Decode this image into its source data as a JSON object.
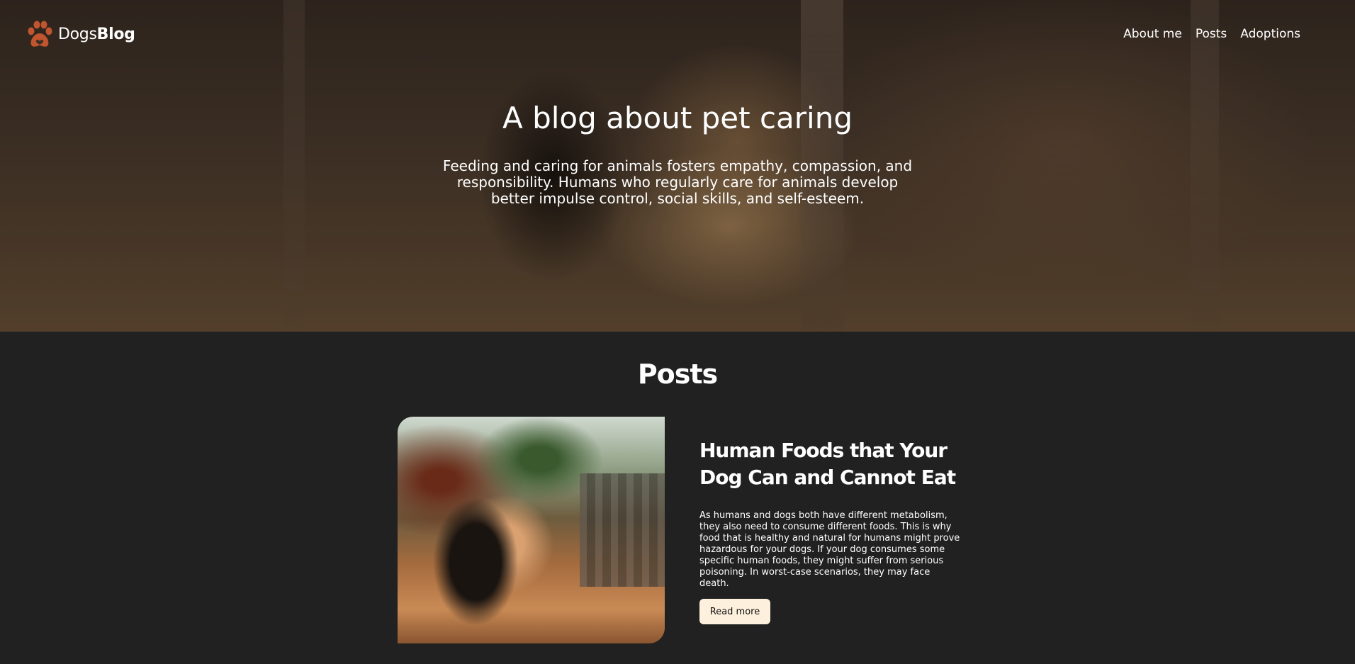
{
  "brand": {
    "name_regular": "Dogs",
    "name_bold": "Blog",
    "icon": "paw-icon",
    "icon_color": "#c0552f"
  },
  "nav": {
    "items": [
      "About me",
      "Posts",
      "Adoptions"
    ]
  },
  "hero": {
    "title": "A blog about pet caring",
    "text": "Feeding and caring for animals fosters empathy, compassion, and responsibility. Humans who regularly care for animals develop better impulse control, social skills, and self-esteem."
  },
  "posts_section": {
    "title": "Posts",
    "posts": [
      {
        "title": "Human Foods that Your Dog Can and Cannot Eat",
        "text": "As humans and dogs both have different metabolism, they also need to consume different foods. This is why food that is healthy and natural for humans might prove hazardous for your dogs. If your dog consumes some specific human foods, they might suffer from serious poisoning. In worst-case scenarios, they may face death.",
        "button": "Read more"
      }
    ]
  },
  "colors": {
    "background": "#212121",
    "button_bg": "#fdf0dc",
    "accent": "#c0552f"
  }
}
